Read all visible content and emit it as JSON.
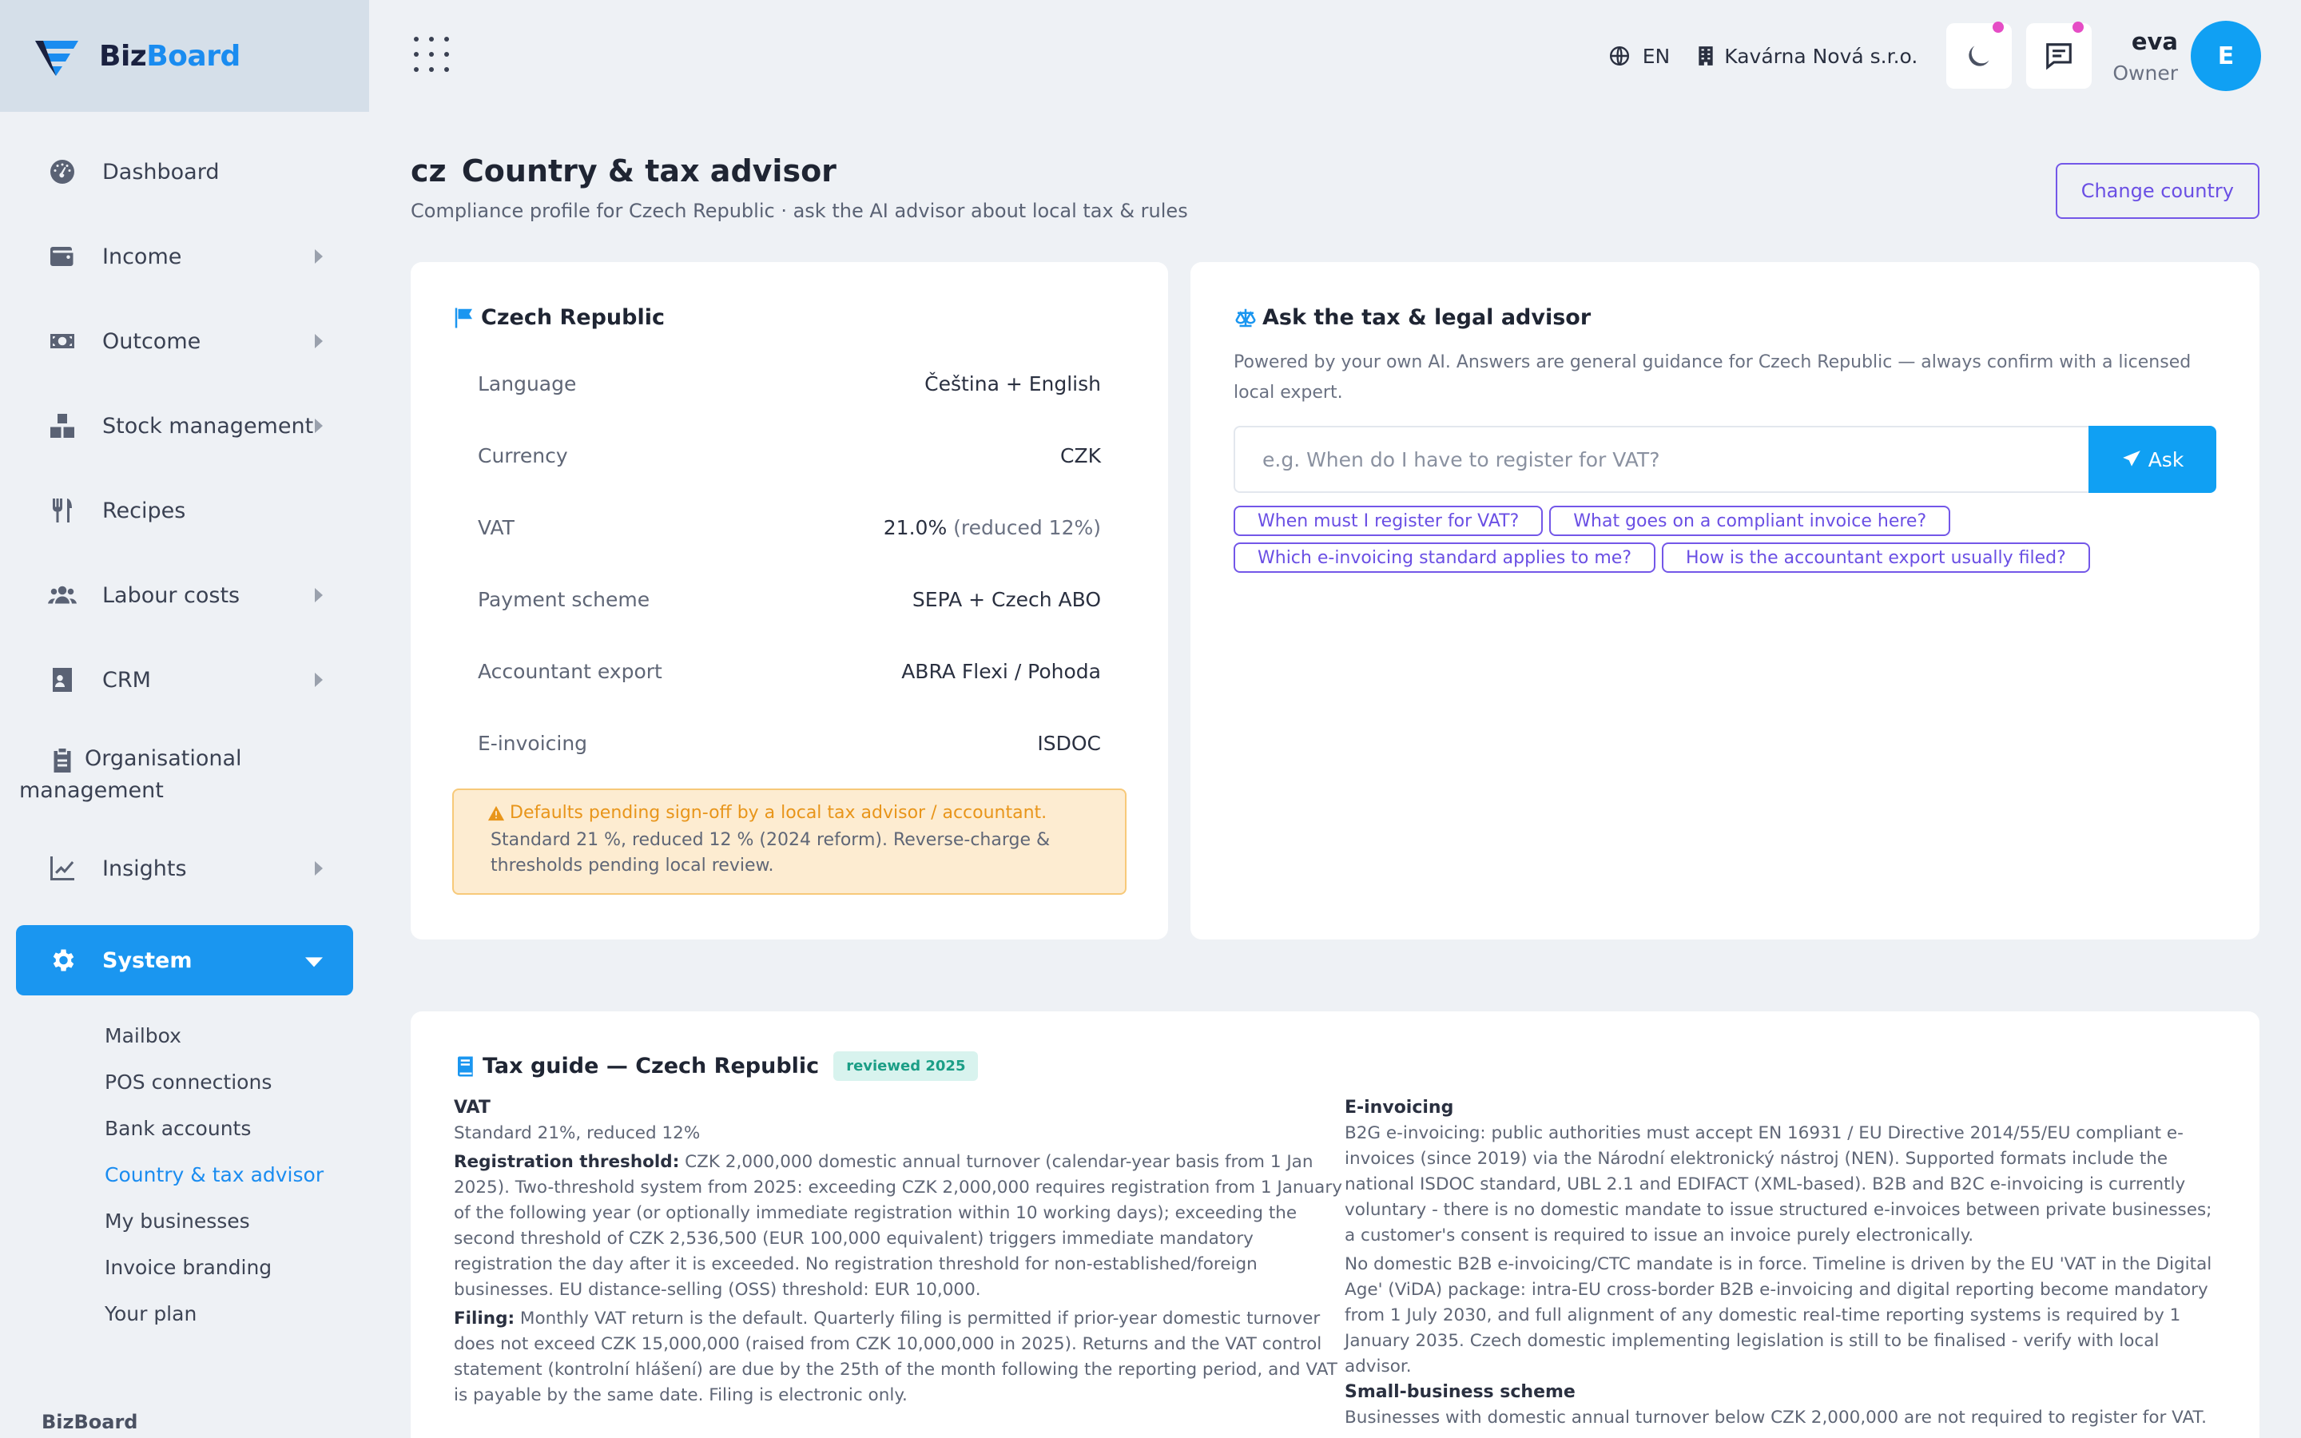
{
  "brand": {
    "name_a": "Biz",
    "name_b": "Board",
    "footer": "BizBoard"
  },
  "sidebar": {
    "items": [
      {
        "label": "Dashboard",
        "icon": "gauge-icon"
      },
      {
        "label": "Income",
        "icon": "wallet-icon"
      },
      {
        "label": "Outcome",
        "icon": "cash-icon"
      },
      {
        "label": "Stock management",
        "icon": "boxes-icon"
      },
      {
        "label": "Recipes",
        "icon": "utensils-icon"
      },
      {
        "label": "Labour costs",
        "icon": "users-icon"
      },
      {
        "label": "CRM",
        "icon": "contact-card-icon"
      },
      {
        "label": "Organisational management",
        "icon": "clipboard-icon"
      },
      {
        "label": "Insights",
        "icon": "chart-line-icon"
      },
      {
        "label": "System",
        "icon": "gear-icon"
      }
    ],
    "system_sub": [
      "Mailbox",
      "POS connections",
      "Bank accounts",
      "Country & tax advisor",
      "My businesses",
      "Invoice branding",
      "Your plan"
    ]
  },
  "topbar": {
    "lang": "EN",
    "company": "Kavárna Nová s.r.o.",
    "user_name": "eva",
    "user_role": "Owner",
    "avatar_initial": "E"
  },
  "page": {
    "country_code": "cz",
    "title": "Country & tax advisor",
    "subtitle": "Compliance profile for Czech Republic · ask the AI advisor about local tax & rules",
    "change_country": "Change country"
  },
  "country_card": {
    "title": "Czech Republic",
    "rows": [
      {
        "key": "Language",
        "value": "Čeština + English",
        "extra": ""
      },
      {
        "key": "Currency",
        "value": "CZK",
        "extra": ""
      },
      {
        "key": "VAT",
        "value": "21.0%",
        "extra": " (reduced 12%)"
      },
      {
        "key": "Payment scheme",
        "value": "SEPA + Czech ABO",
        "extra": ""
      },
      {
        "key": "Accountant export",
        "value": "ABRA Flexi / Pohoda",
        "extra": ""
      },
      {
        "key": "E-invoicing",
        "value": "ISDOC",
        "extra": ""
      }
    ],
    "notice_title": "Defaults pending sign-off by a local tax advisor / accountant.",
    "notice_body": "Standard 21 %, reduced 12 % (2024 reform). Reverse-charge & thresholds pending local review."
  },
  "advisor": {
    "title": "Ask the tax & legal advisor",
    "description": "Powered by your own AI. Answers are general guidance for Czech Republic — always confirm with a licensed local expert.",
    "placeholder": "e.g. When do I have to register for VAT?",
    "ask_label": "Ask",
    "chips": [
      "When must I register for VAT?",
      "What goes on a compliant invoice here?",
      "Which e-invoicing standard applies to me?",
      "How is the accountant export usually filed?"
    ]
  },
  "guide": {
    "title": "Tax guide — Czech Republic",
    "badge": "reviewed 2025",
    "left": {
      "vat_heading": "VAT",
      "vat_rates": "Standard 21%, reduced 12%",
      "reg_label": "Registration threshold:",
      "reg_text": " CZK 2,000,000 domestic annual turnover (calendar-year basis from 1 Jan 2025). Two-threshold system from 2025: exceeding CZK 2,000,000 requires registration from 1 January of the following year (or optionally immediate registration within 10 working days); exceeding the second threshold of CZK 2,536,500 (EUR 100,000 equivalent) triggers immediate mandatory registration the day after it is exceeded. No registration threshold for non-established/foreign businesses. EU distance-selling (OSS) threshold: EUR 10,000.",
      "filing_label": "Filing:",
      "filing_text": " Monthly VAT return is the default. Quarterly filing is permitted if prior-year domestic turnover does not exceed CZK 15,000,000 (raised from CZK 10,000,000 in 2025). Returns and the VAT control statement (kontrolní hlášení) are due by the 25th of the month following the reporting period, and VAT is payable by the same date. Filing is electronic only."
    },
    "right": {
      "einv_heading": "E-invoicing",
      "einv_p1": "B2G e-invoicing: public authorities must accept EN 16931 / EU Directive 2014/55/EU compliant e-invoices (since 2019) via the Národní elektronický nástroj (NEN). Supported formats include the national ISDOC standard, UBL 2.1 and EDIFACT (XML-based). B2B and B2C e-invoicing is currently voluntary - there is no domestic mandate to issue structured e-invoices between private businesses; a customer's consent is required to issue an invoice purely electronically.",
      "einv_p2": "No domestic B2B e-invoicing/CTC mandate is in force. Timeline is driven by the EU 'VAT in the Digital Age' (ViDA) package: intra-EU cross-border B2B e-invoicing and digital reporting become mandatory from 1 July 2030, and full alignment of any domestic real-time reporting systems is required by 1 January 2035. Czech domestic implementing legislation is still to be finalised - verify with local advisor.",
      "small_heading": "Small-business scheme",
      "small_text": "Businesses with domestic annual turnover below CZK 2,000,000 are not required to register for VAT."
    }
  },
  "colors": {
    "accent": "#1a96f0",
    "purple": "#7357e8",
    "warning": "#e8951a",
    "badge": "#1b9e86"
  }
}
